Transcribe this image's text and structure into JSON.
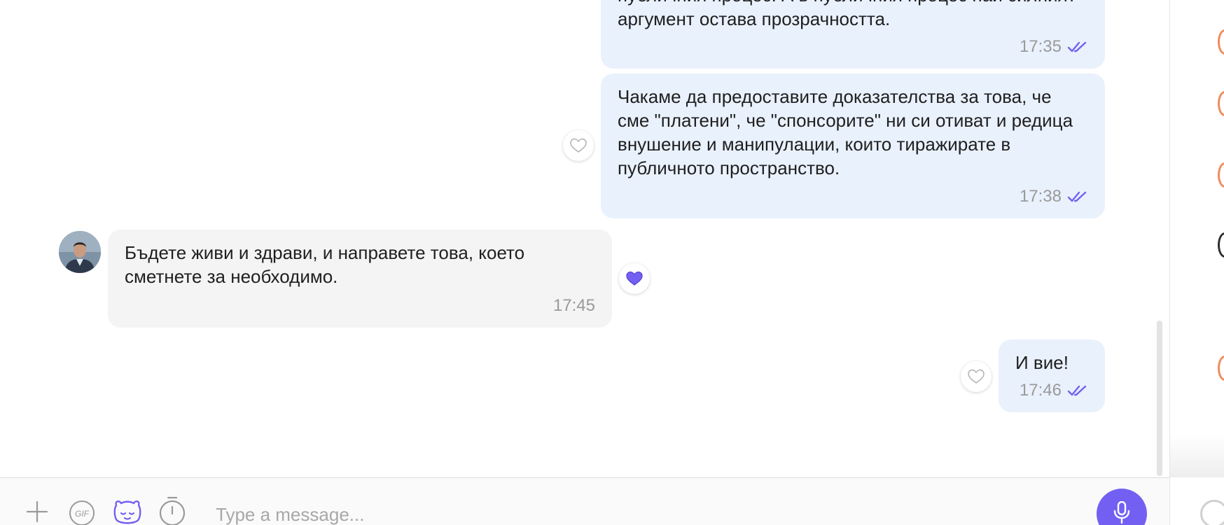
{
  "messages": [
    {
      "direction": "outgoing",
      "text": "публичния процес. А в публичния процес най силният аргумент остава прозрачността.",
      "time": "17:35",
      "status": "read"
    },
    {
      "direction": "outgoing",
      "text": "Чакаме да предоставите доказателства за това, че сме \"платени\", че \"спонсорите\" ни си отиват и редица внушение и манипулации, които тиражирате в публичното пространство.",
      "time": "17:38",
      "status": "read",
      "liked": false
    },
    {
      "direction": "incoming",
      "text": "Бъдете живи и здрави, и направете това, което сметнете за необходимо.",
      "time": "17:45",
      "liked": true
    },
    {
      "direction": "outgoing",
      "text": "И вие!",
      "time": "17:46",
      "status": "read",
      "liked": false
    }
  ],
  "composer": {
    "placeholder": "Type a message...",
    "icons": [
      "plus-icon",
      "gif-icon",
      "sticker-icon",
      "timer-icon",
      "microphone-icon"
    ]
  },
  "colors": {
    "accent": "#7360f2",
    "outgoing_bubble": "#e9f1fd",
    "incoming_bubble": "#f4f4f4",
    "timestamp": "#9a9a9a"
  }
}
